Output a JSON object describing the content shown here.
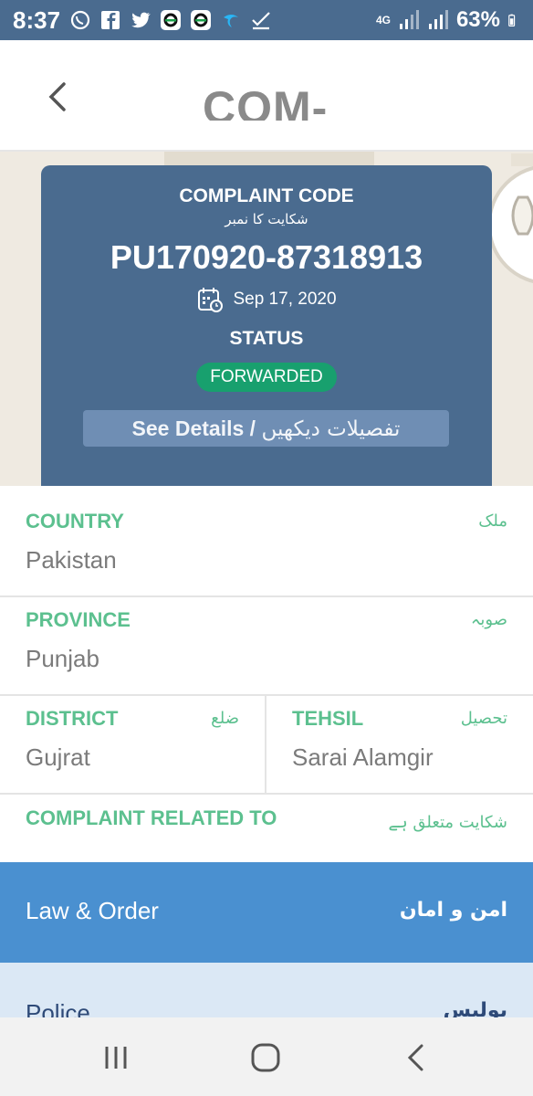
{
  "status_bar": {
    "time": "8:37",
    "network": "4G",
    "battery": "63%",
    "icons": [
      "whatsapp-icon",
      "facebook-icon",
      "twitter-icon",
      "app-icon",
      "app-icon",
      "telenor-icon",
      "check-icon",
      "signal-icon",
      "battery-icon"
    ]
  },
  "header": {
    "title": "COM-"
  },
  "card": {
    "code_label": "COMPLAINT CODE",
    "code_label_urdu": "شکایت کا نمبر",
    "code": "PU170920-87318913",
    "date": "Sep 17, 2020",
    "status_label": "STATUS",
    "status": "FORWARDED",
    "details_en": "See Details /",
    "details_ur": "تفصیلات دیکھیں"
  },
  "fields": {
    "country": {
      "label": "COUNTRY",
      "label_urdu": "ملک",
      "value": "Pakistan"
    },
    "province": {
      "label": "PROVINCE",
      "label_urdu": "صوبہ",
      "value": "Punjab"
    },
    "district": {
      "label": "DISTRICT",
      "label_urdu": "ضلع",
      "value": "Gujrat"
    },
    "tehsil": {
      "label": "TEHSIL",
      "label_urdu": "تحصیل",
      "value": "Sarai Alamgir"
    },
    "related": {
      "label": "COMPLAINT RELATED TO",
      "label_urdu": "شکایت متعلق ہے"
    }
  },
  "options": [
    {
      "en": "Law & Order",
      "ur": "امن و امان"
    },
    {
      "en": "Police",
      "ur": "پولیس"
    }
  ],
  "colors": {
    "primary": "#4a6b8f",
    "accent_green": "#5cc08f",
    "status_green": "#18a06e",
    "selected_blue": "#4a90d0",
    "light_blue": "#dbe8f5"
  }
}
